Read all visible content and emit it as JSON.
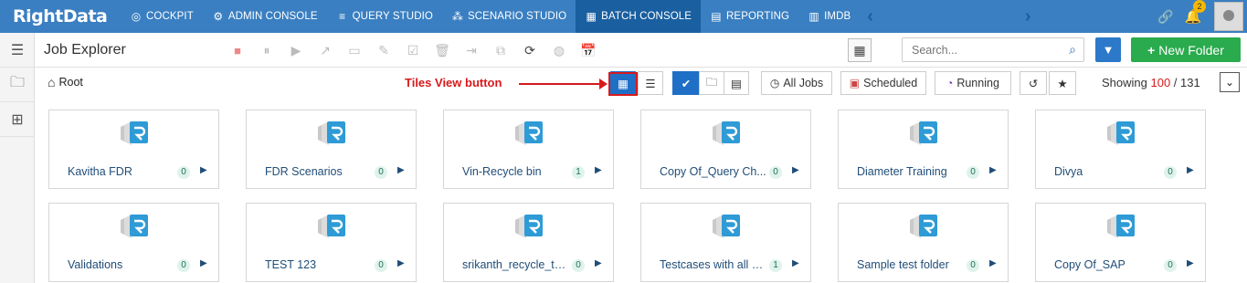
{
  "topnav": {
    "logo": "RightData",
    "items": [
      {
        "label": "COCKPIT",
        "icon": "cockpit-icon"
      },
      {
        "label": "ADMIN CONSOLE",
        "icon": "gear-icon"
      },
      {
        "label": "QUERY STUDIO",
        "icon": "database-icon"
      },
      {
        "label": "SCENARIO STUDIO",
        "icon": "scenario-icon"
      },
      {
        "label": "BATCH CONSOLE",
        "icon": "batch-icon",
        "active": true
      },
      {
        "label": "REPORTING",
        "icon": "report-icon"
      },
      {
        "label": "IMDB",
        "icon": "imdb-icon"
      }
    ],
    "notification_count": "2"
  },
  "header": {
    "title": "Job Explorer",
    "search_placeholder": "Search...",
    "new_folder_label": "New Folder"
  },
  "viewbar": {
    "breadcrumb": "Root",
    "annotation": "Tiles View button",
    "all_jobs": "All Jobs",
    "scheduled": "Scheduled",
    "running": "Running",
    "showing_prefix": "Showing ",
    "showing_count": "100",
    "showing_total": " / 131"
  },
  "tiles": [
    {
      "name": "Kavitha FDR",
      "count": "0"
    },
    {
      "name": "FDR Scenarios",
      "count": "0"
    },
    {
      "name": "Vin-Recycle bin",
      "count": "1"
    },
    {
      "name": "Copy Of_Query Ch...",
      "count": "0"
    },
    {
      "name": "Diameter Training",
      "count": "0"
    },
    {
      "name": "Divya",
      "count": "0"
    },
    {
      "name": "Validations",
      "count": "0"
    },
    {
      "name": "TEST 123",
      "count": "0"
    },
    {
      "name": "srikanth_recycle_te...",
      "count": "0"
    },
    {
      "name": "Testcases with all d...",
      "count": "1"
    },
    {
      "name": "Sample test folder",
      "count": "0"
    },
    {
      "name": "Copy Of_SAP",
      "count": "0"
    }
  ],
  "colors": {
    "nav_bg": "#3a7fc1",
    "nav_active": "#1a5fa0",
    "accent_green": "#2aab4d",
    "accent_blue": "#1f6fc6",
    "annotation_red": "#d8191c"
  }
}
